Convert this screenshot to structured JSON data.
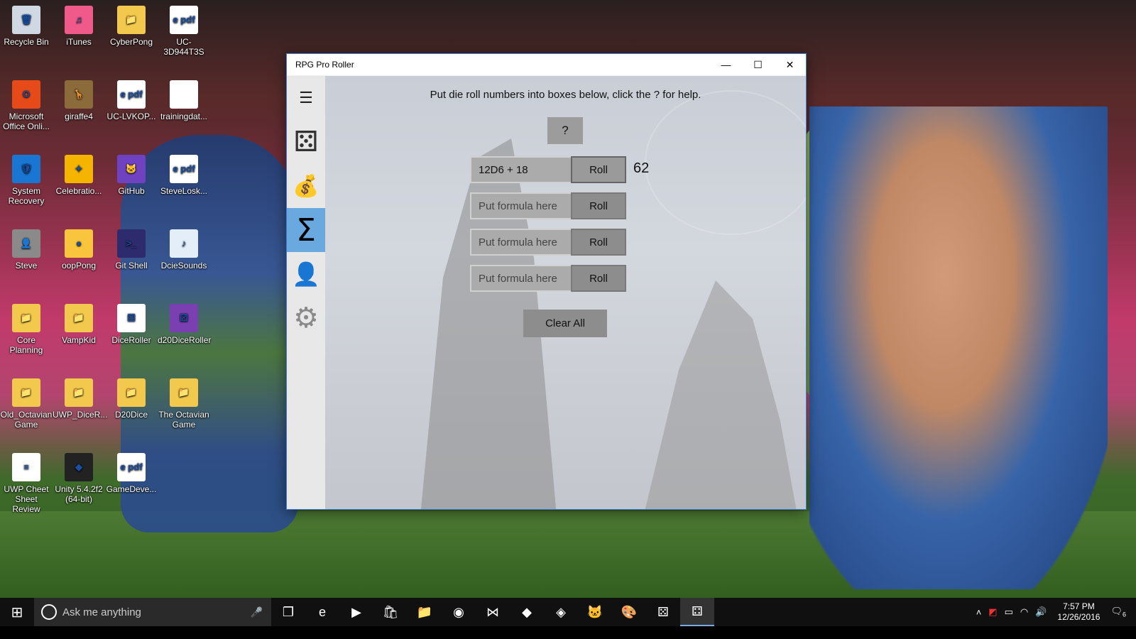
{
  "desktop": {
    "icons": [
      {
        "label": "Recycle Bin",
        "glyph": "🗑",
        "color": "#cfd8e3"
      },
      {
        "label": "iTunes",
        "glyph": "♫",
        "color": "#f05a8a"
      },
      {
        "label": "CyberPong",
        "glyph": "📁",
        "color": "#f2c94c"
      },
      {
        "label": "UC-3D944T3S",
        "glyph": "e pdf",
        "color": "#ffffff"
      },
      {
        "label": "Microsoft Office Onli...",
        "glyph": "O",
        "color": "#e64a19"
      },
      {
        "label": "giraffe4",
        "glyph": "🦒",
        "color": "#8b6b3a"
      },
      {
        "label": "UC-LVKOP...",
        "glyph": "e pdf",
        "color": "#ffffff"
      },
      {
        "label": "trainingdat...",
        "glyph": "",
        "color": "#ffffff"
      },
      {
        "label": "System Recovery",
        "glyph": "🛡",
        "color": "#1976d2"
      },
      {
        "label": "Celebratio...",
        "glyph": "✦",
        "color": "#f4b400"
      },
      {
        "label": "GitHub",
        "glyph": "🐱",
        "color": "#6f42c1"
      },
      {
        "label": "SteveLosk...",
        "glyph": "e pdf",
        "color": "#ffffff"
      },
      {
        "label": "Steve",
        "glyph": "👤",
        "color": "#8a8a8a"
      },
      {
        "label": "oopPong",
        "glyph": "●",
        "color": "#f9c53c"
      },
      {
        "label": "Git Shell",
        "glyph": ">_",
        "color": "#2d2a6e"
      },
      {
        "label": "DcieSounds",
        "glyph": "♪",
        "color": "#e3eef9"
      },
      {
        "label": "Core Planning",
        "glyph": "📁",
        "color": "#f2c94c"
      },
      {
        "label": "VampKid",
        "glyph": "📁",
        "color": "#f2c94c"
      },
      {
        "label": "DiceRoller",
        "glyph": "⚄",
        "color": "#ffffff"
      },
      {
        "label": "d20DiceRoller",
        "glyph": "⚂",
        "color": "#7a3fb0"
      },
      {
        "label": "Old_Octavian Game",
        "glyph": "📁",
        "color": "#f2c94c"
      },
      {
        "label": "UWP_DiceR...",
        "glyph": "📁",
        "color": "#f2c94c"
      },
      {
        "label": "D20Dice",
        "glyph": "📁",
        "color": "#f2c94c"
      },
      {
        "label": "The Octavian Game",
        "glyph": "📁",
        "color": "#f2c94c"
      },
      {
        "label": "UWP Cheet Sheet Review",
        "glyph": "≡",
        "color": "#ffffff"
      },
      {
        "label": "Unity 5.4.2f2 (64-bit)",
        "glyph": "◆",
        "color": "#222222"
      },
      {
        "label": "GameDeve...",
        "glyph": "e pdf",
        "color": "#ffffff"
      }
    ]
  },
  "window": {
    "title": "RPG Pro Roller",
    "controls": {
      "minimize": "—",
      "maximize": "☐",
      "close": "✕"
    }
  },
  "nav": {
    "items": [
      {
        "name": "hamburger-menu-icon",
        "glyph": "☰"
      },
      {
        "name": "dice-icon",
        "glyph": "⚄"
      },
      {
        "name": "money-bag-icon",
        "glyph": "💰"
      },
      {
        "name": "sigma-icon",
        "glyph": "Σ",
        "active": true
      },
      {
        "name": "person-icon",
        "glyph": "👤"
      },
      {
        "name": "gear-icon",
        "glyph": "⚙"
      }
    ]
  },
  "main": {
    "instructions": "Put die roll numbers into boxes below, click the ? for help.",
    "help_label": "?",
    "rows": [
      {
        "value": "12D6 + 18",
        "placeholder": "Put formula here",
        "roll_label": "Roll",
        "result": "62"
      },
      {
        "value": "",
        "placeholder": "Put formula here",
        "roll_label": "Roll",
        "result": ""
      },
      {
        "value": "",
        "placeholder": "Put formula here",
        "roll_label": "Roll",
        "result": ""
      },
      {
        "value": "",
        "placeholder": "Put formula here",
        "roll_label": "Roll",
        "result": ""
      }
    ],
    "clear_label": "Clear All"
  },
  "taskbar": {
    "search_placeholder": "Ask me anything",
    "apps": [
      {
        "name": "task-view-icon",
        "glyph": "❐"
      },
      {
        "name": "edge-icon",
        "glyph": "e"
      },
      {
        "name": "media-player-icon",
        "glyph": "▶"
      },
      {
        "name": "store-icon",
        "glyph": "🛍"
      },
      {
        "name": "file-explorer-icon",
        "glyph": "📁"
      },
      {
        "name": "chrome-icon",
        "glyph": "◉"
      },
      {
        "name": "visual-studio-icon",
        "glyph": "⋈"
      },
      {
        "name": "unity-icon",
        "glyph": "◆"
      },
      {
        "name": "git-extensions-icon",
        "glyph": "◈"
      },
      {
        "name": "github-icon",
        "glyph": "🐱"
      },
      {
        "name": "paint-icon",
        "glyph": "🎨"
      },
      {
        "name": "dice-app-icon",
        "glyph": "⚄"
      },
      {
        "name": "rpg-pro-roller-icon",
        "glyph": "⚃",
        "active": true
      }
    ],
    "tray": {
      "clock_time": "7:57 PM",
      "clock_date": "12/26/2016",
      "notifications": "6"
    }
  },
  "colors": {
    "accent": "#6aa8e0",
    "window_border": "#3a7bd5"
  }
}
